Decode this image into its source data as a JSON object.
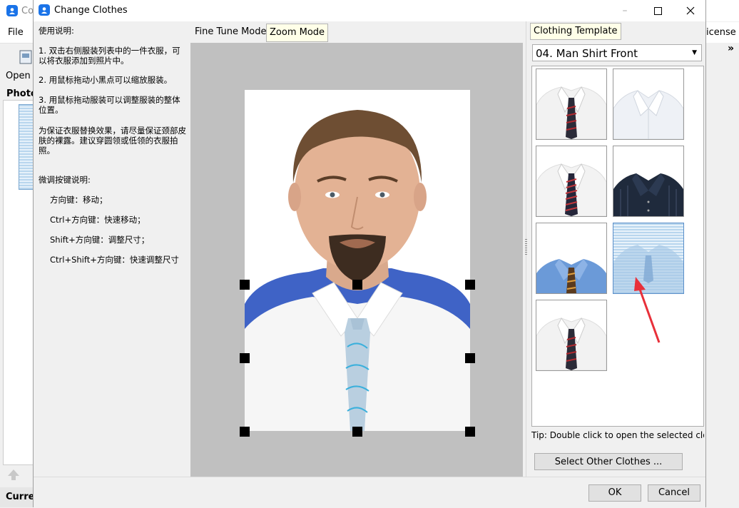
{
  "background_app": {
    "title_fragment": "Co",
    "menu_file": "File",
    "menu_license_fragment": "icense",
    "toolbar_open": "Open",
    "photo_label": "Photo",
    "footer_fragment": "Curren",
    "overflow_chevron": "»"
  },
  "dialog": {
    "title": "Change Clothes",
    "minimize": "–",
    "maximize": "☐",
    "close": "✕"
  },
  "instructions": {
    "heading": "使用说明:",
    "step1": "1. 双击右侧服装列表中的一件衣服，可以将衣服添加到照片中。",
    "step2": "2. 用鼠标拖动小黑点可以缩放服装。",
    "step3": "3. 用鼠标拖动服装可以调整服装的整体位置。",
    "note": "为保证衣服替换效果，请尽量保证颈部皮肤的裸露。建议穿圆领或低领的衣服拍照。",
    "fine_keys_heading": "微调按键说明:",
    "key1": "方向键：移动；",
    "key2": "Ctrl+方向键：快速移动；",
    "key3": "Shift+方向键：调整尺寸；",
    "key4": "Ctrl+Shift+方向键：快速调整尺寸"
  },
  "modes": {
    "fine_tune": "Fine Tune Mode",
    "zoom": "Zoom Mode",
    "active": "zoom"
  },
  "right_panel": {
    "tab": "Clothing Template",
    "template_selected": "04. Man Shirt Front",
    "tip": "Tip: Double click to open the selected cloth",
    "select_other": "Select Other Clothes ..."
  },
  "clothes": [
    {
      "name": "white-shirt-dark-tie",
      "selected": false
    },
    {
      "name": "white-shirt-open-collar",
      "selected": false
    },
    {
      "name": "white-shirt-red-striped-tie",
      "selected": false
    },
    {
      "name": "dark-striped-shirt",
      "selected": false
    },
    {
      "name": "blue-shirt-patterned-tie",
      "selected": false
    },
    {
      "name": "light-blue-shirt",
      "selected": true
    },
    {
      "name": "white-shirt-dark-tie-2",
      "selected": false
    }
  ],
  "buttons": {
    "ok": "OK",
    "cancel": "Cancel"
  },
  "colors": {
    "accent_blue": "#1a73e8",
    "active_tab_bg": "#ffffe8",
    "annotation_arrow": "#e8303a"
  }
}
